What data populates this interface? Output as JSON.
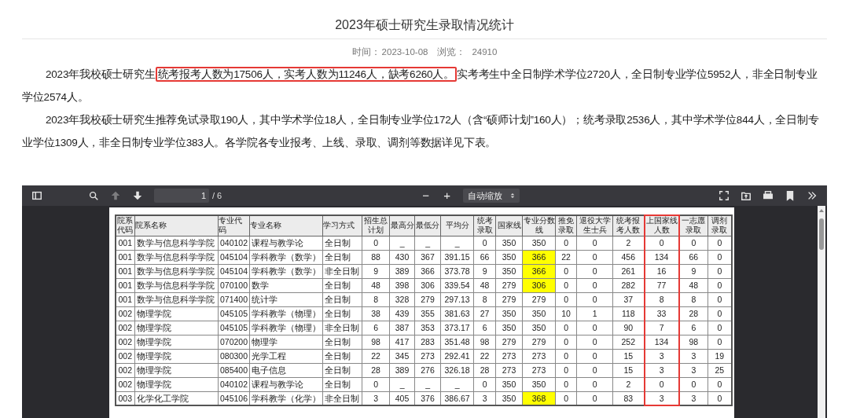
{
  "article": {
    "title": "2023年硕士研究生录取情况统计",
    "meta": {
      "time_label": "时间：",
      "time": "2023-10-08",
      "views_label": "浏览：",
      "views": "24910"
    },
    "paragraphs": [
      {
        "segments": [
          {
            "text": "2023年我校硕士研究生",
            "boxed": false
          },
          {
            "text": "统考报考人数为17506人，实考人数为11246人，缺考6260人。",
            "boxed": true
          },
          {
            "text": "实考考生中全日制学术学位2720人，全日制专业学位5952人，非全日制专业学位2574人。",
            "boxed": false
          }
        ]
      },
      {
        "segments": [
          {
            "text": "2023年我校硕士研究生推荐免试录取190人，其中学术学位18人，全日制专业学位172人（含“硕师计划”160人）；统考录取2536人，其中学术学位844人，全日制专业学位1309人，非全日制专业学位383人。各学院各专业报考、上线、录取、调剂等数据详见下表。",
            "boxed": false
          }
        ]
      }
    ]
  },
  "pdf_viewer": {
    "toolbar": {
      "previous_page_disabled": true,
      "page": "1",
      "page_count": "/ 6",
      "minus": "−",
      "plus": "+",
      "zoom": "自动缩放"
    },
    "table": {
      "columns": [
        {
          "label": "院系代码",
          "kind": "number",
          "boxed": false
        },
        {
          "label": "院系名称",
          "kind": "text",
          "boxed": false
        },
        {
          "label": "专业代码",
          "kind": "text",
          "boxed": false
        },
        {
          "label": "专业名称",
          "kind": "text",
          "boxed": false
        },
        {
          "label": "学习方式",
          "kind": "text",
          "boxed": false
        },
        {
          "label": "招生总计划",
          "kind": "number",
          "boxed": false
        },
        {
          "label": "最高分",
          "kind": "number",
          "boxed": false
        },
        {
          "label": "最低分",
          "kind": "number",
          "boxed": false
        },
        {
          "label": "平均分",
          "kind": "number",
          "boxed": false
        },
        {
          "label": "统考录取",
          "kind": "number",
          "boxed": false
        },
        {
          "label": "国家线",
          "kind": "number",
          "boxed": false
        },
        {
          "label": "专业分数线",
          "kind": "number",
          "boxed": false
        },
        {
          "label": "推免录取",
          "kind": "number",
          "boxed": false
        },
        {
          "label": "退役大学生士兵",
          "kind": "number",
          "boxed": false
        },
        {
          "label": "统考报考人数",
          "kind": "number",
          "boxed": false
        },
        {
          "label": "上国家线人数",
          "kind": "number",
          "boxed": true
        },
        {
          "label": "一志愿录取",
          "kind": "number",
          "boxed": false
        },
        {
          "label": "调剂录取",
          "kind": "number",
          "boxed": false
        }
      ],
      "rows": [
        {
          "line_highlighted": false,
          "cells": [
            "001",
            "数学与信息科学学院",
            "040102",
            "课程与教学论",
            "全日制",
            "0",
            "_",
            "_",
            "_",
            "0",
            "350",
            "350",
            "0",
            "0",
            "2",
            "0",
            "0",
            "0"
          ]
        },
        {
          "line_highlighted": true,
          "cells": [
            "001",
            "数学与信息科学学院",
            "045104",
            "学科教学（数学）",
            "全日制",
            "88",
            "430",
            "367",
            "391.15",
            "66",
            "350",
            "366",
            "22",
            "0",
            "456",
            "134",
            "66",
            "0"
          ]
        },
        {
          "line_highlighted": true,
          "cells": [
            "001",
            "数学与信息科学学院",
            "045104",
            "学科教学（数学）",
            "非全日制",
            "9",
            "389",
            "366",
            "373.78",
            "9",
            "350",
            "366",
            "0",
            "0",
            "261",
            "16",
            "9",
            "0"
          ]
        },
        {
          "line_highlighted": true,
          "cells": [
            "001",
            "数学与信息科学学院",
            "070100",
            "数学",
            "全日制",
            "48",
            "398",
            "306",
            "339.54",
            "48",
            "279",
            "306",
            "0",
            "0",
            "282",
            "77",
            "48",
            "0"
          ]
        },
        {
          "line_highlighted": false,
          "cells": [
            "001",
            "数学与信息科学学院",
            "071400",
            "统计学",
            "全日制",
            "8",
            "328",
            "279",
            "297.13",
            "8",
            "279",
            "279",
            "0",
            "0",
            "37",
            "8",
            "8",
            "0"
          ]
        },
        {
          "line_highlighted": false,
          "cells": [
            "002",
            "物理学院",
            "045105",
            "学科教学（物理）",
            "全日制",
            "38",
            "439",
            "355",
            "381.63",
            "27",
            "350",
            "350",
            "10",
            "1",
            "118",
            "33",
            "28",
            "0"
          ]
        },
        {
          "line_highlighted": false,
          "cells": [
            "002",
            "物理学院",
            "045105",
            "学科教学（物理）",
            "非全日制",
            "6",
            "387",
            "353",
            "373.17",
            "6",
            "350",
            "350",
            "0",
            "0",
            "90",
            "7",
            "6",
            "0"
          ]
        },
        {
          "line_highlighted": false,
          "cells": [
            "002",
            "物理学院",
            "070200",
            "物理学",
            "全日制",
            "98",
            "417",
            "283",
            "351.48",
            "98",
            "279",
            "279",
            "0",
            "0",
            "252",
            "134",
            "98",
            "0"
          ]
        },
        {
          "line_highlighted": false,
          "cells": [
            "002",
            "物理学院",
            "080300",
            "光学工程",
            "全日制",
            "22",
            "345",
            "273",
            "292.41",
            "22",
            "273",
            "273",
            "0",
            "0",
            "15",
            "3",
            "3",
            "19"
          ]
        },
        {
          "line_highlighted": false,
          "cells": [
            "002",
            "物理学院",
            "085400",
            "电子信息",
            "全日制",
            "28",
            "389",
            "276",
            "326.18",
            "28",
            "273",
            "273",
            "0",
            "0",
            "15",
            "3",
            "3",
            "25"
          ]
        },
        {
          "line_highlighted": false,
          "cells": [
            "002",
            "物理学院",
            "040102",
            "课程与教学论",
            "全日制",
            "0",
            "_",
            "_",
            "_",
            "0",
            "350",
            "350",
            "0",
            "0",
            "2",
            "0",
            "0",
            "0"
          ]
        },
        {
          "line_highlighted": true,
          "cells": [
            "003",
            "化学化工学院",
            "045106",
            "学科教学（化学）",
            "非全日制",
            "3",
            "405",
            "376",
            "386.67",
            "3",
            "350",
            "368",
            "0",
            "0",
            "83",
            "3",
            "3",
            "0"
          ]
        }
      ]
    }
  }
}
